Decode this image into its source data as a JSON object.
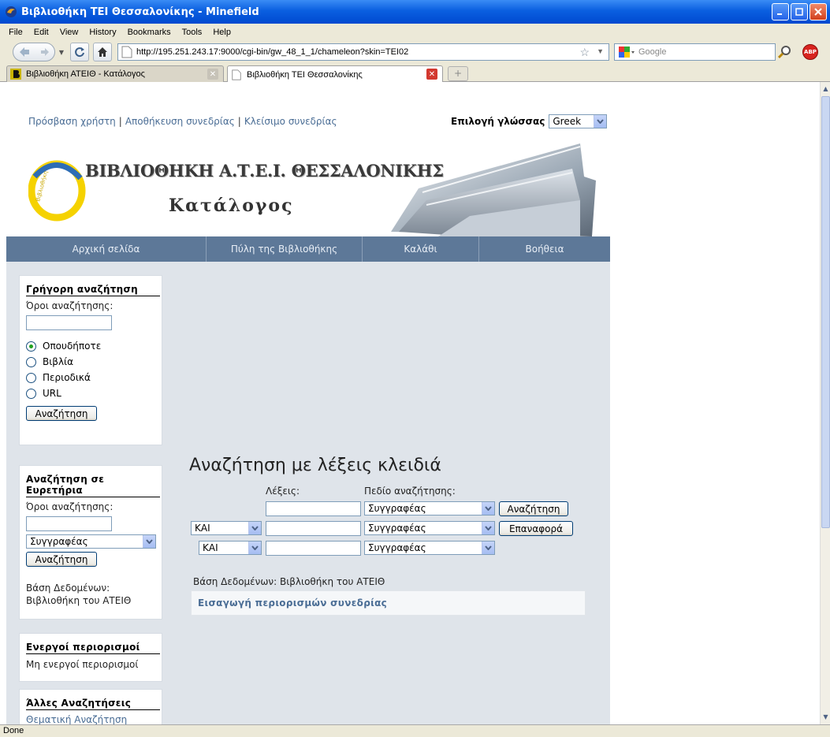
{
  "window": {
    "title": "Βιβλιοθήκη ΤΕΙ Θεσσαλονίκης - Minefield"
  },
  "menu": [
    "File",
    "Edit",
    "View",
    "History",
    "Bookmarks",
    "Tools",
    "Help"
  ],
  "navbar": {
    "url": "http://195.251.243.17:9000/cgi-bin/gw_48_1_1/chameleon?skin=TEI02",
    "search_placeholder": "Google"
  },
  "tabs": [
    {
      "label": "Βιβλιοθήκη ΑΤΕΙΘ - Κατάλογος",
      "active": false
    },
    {
      "label": "Βιβλιοθήκη ΤΕΙ Θεσσαλονίκης",
      "active": true
    }
  ],
  "page": {
    "top_links": [
      "Πρόσβαση χρήστη",
      "Αποθήκευση συνεδρίας",
      "Κλείσιμο συνεδρίας"
    ],
    "language": {
      "label": "Επιλογή γλώσσας",
      "value": "Greek"
    },
    "banner": {
      "title": "ΒΙΒΛΙΟΘΗΚΗ Α.Τ.Ε.Ι. ΘΕΣΣΑΛΟΝΙΚΗΣ",
      "subtitle": "Κατάλογος"
    },
    "nav": [
      "Αρχική σελίδα",
      "Πύλη της Βιβλιοθήκης",
      "Καλάθι",
      "Βοήθεια"
    ],
    "quick_search": {
      "title": "Γρήγορη αναζήτηση",
      "terms_label": "Όροι αναζήτησης:",
      "options": [
        "Οπουδήποτε",
        "Βιβλία",
        "Περιοδικά",
        "URL"
      ],
      "selected": 0,
      "button": "Αναζήτηση"
    },
    "index_search": {
      "title": "Αναζήτηση σε Ευρετήρια",
      "terms_label": "Όροι αναζήτησης:",
      "field": "Συγγραφέας",
      "button": "Αναζήτηση",
      "db_label": "Βάση Δεδομένων:",
      "db_value": "Βιβλιοθήκη του ΑΤΕΙΘ"
    },
    "active_limits": {
      "title": "Ενεργοί περιορισμοί",
      "text": "Μη ενεργοί περιορισμοί"
    },
    "other_searches": {
      "title": "Άλλες Αναζητήσεις",
      "link": "Θεματική Αναζήτηση"
    },
    "keyword_search": {
      "title": "Αναζήτηση με λέξεις κλειδιά",
      "words_label": "Λέξεις:",
      "field_label": "Πεδίο αναζήτησης:",
      "rows": [
        {
          "op": "",
          "field": "Συγγραφέας"
        },
        {
          "op": "ΚΑΙ",
          "field": "Συγγραφέας"
        },
        {
          "op": "ΚΑΙ",
          "field": "Συγγραφέας"
        }
      ],
      "search_button": "Αναζήτηση",
      "reset_button": "Επαναφορά",
      "db_line": "Βάση Δεδομένων: Βιβλιοθήκη του ΑΤΕΙΘ",
      "limits_link": "Εισαγωγή περιορισμών συνεδρίας"
    }
  },
  "status": "Done"
}
